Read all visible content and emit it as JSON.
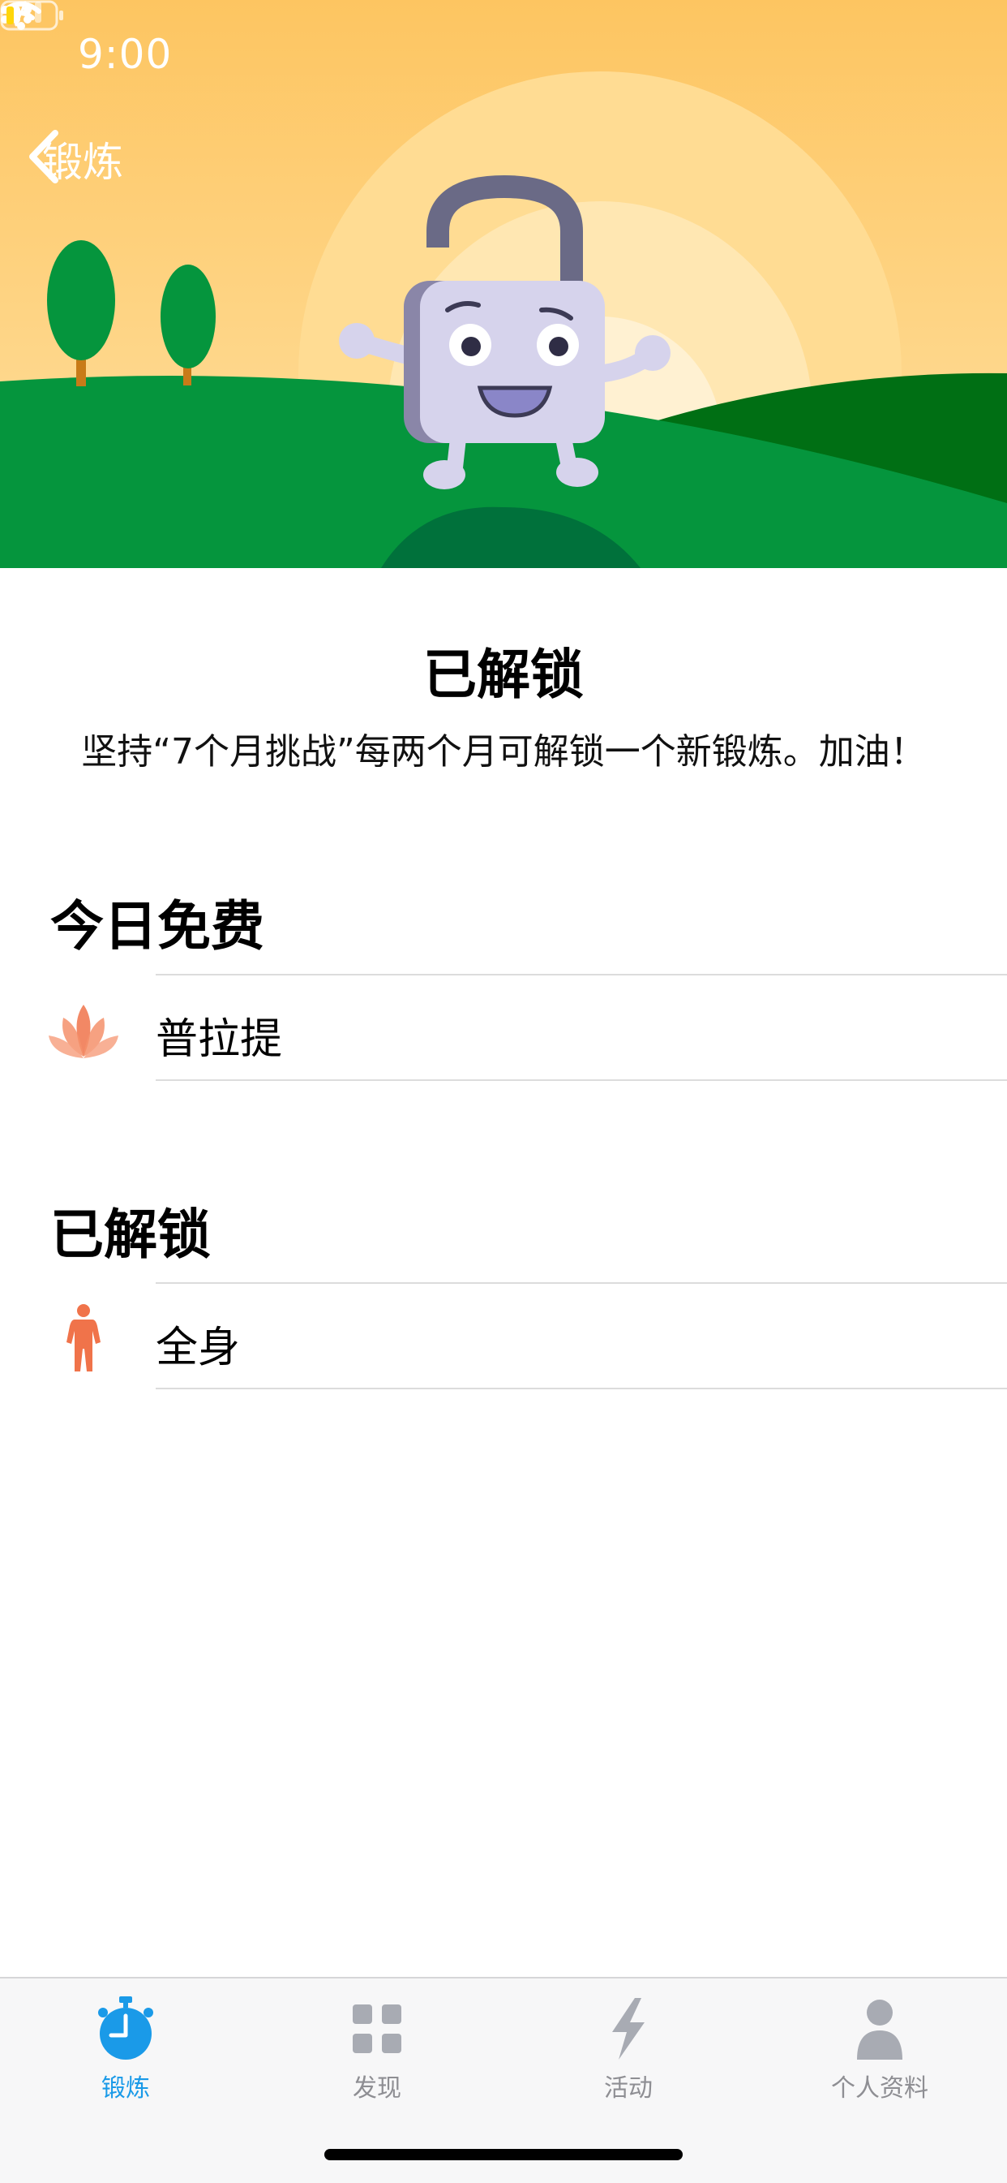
{
  "status_bar": {
    "time": "9:00"
  },
  "nav": {
    "back_label": "锻炼"
  },
  "header": {
    "title": "已解锁",
    "subtitle": "坚持“7个月挑战”每两个月可解锁一个新锻炼。加油！"
  },
  "sections": [
    {
      "title": "今日免费",
      "items": [
        {
          "label": "普拉提",
          "icon": "lotus-icon"
        }
      ]
    },
    {
      "title": "已解锁",
      "items": [
        {
          "label": "全身",
          "icon": "person-icon"
        }
      ]
    }
  ],
  "tab_bar": {
    "tabs": [
      {
        "label": "锻炼",
        "icon": "stopwatch-icon",
        "active": true
      },
      {
        "label": "发现",
        "icon": "grid-icon",
        "active": false
      },
      {
        "label": "活动",
        "icon": "lightning-icon",
        "active": false
      },
      {
        "label": "个人资料",
        "icon": "profile-icon",
        "active": false
      }
    ]
  },
  "colors": {
    "accent": "#1a9ae8",
    "sky_top": "#fdc561",
    "grass": "#05953d",
    "grass_dark": "#006f14",
    "item_icon": "#f0734a",
    "inactive_tab": "#8e8e93"
  }
}
